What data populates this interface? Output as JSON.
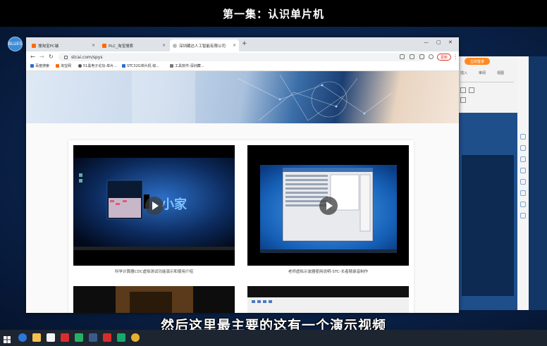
{
  "video": {
    "title": "第一集：认识单片机",
    "subtitle": "然后这里最主要的这有一个演示视频"
  },
  "desktop": {
    "icon_label": "BLUES"
  },
  "browser": {
    "tabs": [
      {
        "label": "搜淘宝PC端",
        "color": "#ff6a00",
        "active": false
      },
      {
        "label": "PLC_淘宝搜索",
        "color": "#ff6a00",
        "active": false
      },
      {
        "label": "深圳藏达人工智能有限公司",
        "color": "#999999",
        "active": true
      }
    ],
    "url": "stcai.com/spys",
    "update_label": "更新",
    "bookmarks": [
      {
        "label": "百度搜索",
        "color": "#2b6cd4"
      },
      {
        "label": "淘宝网",
        "color": "#ff6a00"
      },
      {
        "label": "51黑电子论坛-单片...",
        "color": "#555555"
      },
      {
        "label": "STC32G单片机 综...",
        "color": "#2b6cd4"
      },
      {
        "label": "工具软件-深圳藏...",
        "color": "#777777"
      }
    ]
  },
  "videos": [
    {
      "caption": "科学计算器CDC虚拟测试功能演示和使用介绍",
      "watermark": "小家"
    },
    {
      "caption": "老师虚拟示波器使用说明-STC-长者随录音制作"
    }
  ],
  "doc_window": {
    "button_label": "立即登录",
    "toolbar_items": [
      "插入",
      "审阅",
      "视图"
    ]
  },
  "colors": {
    "accent": "#ff8a1f",
    "update_red": "#d93025"
  }
}
